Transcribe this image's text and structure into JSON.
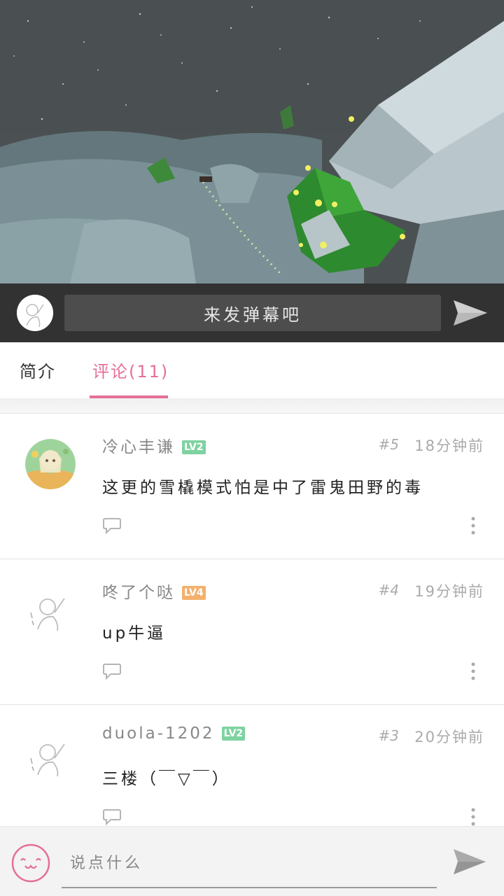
{
  "video": {
    "label": "video-frame"
  },
  "danmaku": {
    "placeholder": "来发弹幕吧"
  },
  "tabs": [
    {
      "label": "简介"
    },
    {
      "label": "评论(11)"
    }
  ],
  "comments": [
    {
      "username": "冷心丰谦",
      "level": "LV2",
      "floor": "#5",
      "time": "18分钟前",
      "text": "这更的雪橇模式怕是中了雷鬼田野的毒"
    },
    {
      "username": "咚了个哒",
      "level": "LV4",
      "floor": "#4",
      "time": "19分钟前",
      "text": "up牛逼"
    },
    {
      "username": "duola-1202",
      "level": "LV2",
      "floor": "#3",
      "time": "20分钟前",
      "text": "三楼（￣▽￣）"
    }
  ],
  "bottom_bar": {
    "placeholder": "说点什么"
  },
  "colors": {
    "accent": "#e56f99",
    "lv2": "#7ed3a1",
    "lv4": "#f5b06d"
  }
}
